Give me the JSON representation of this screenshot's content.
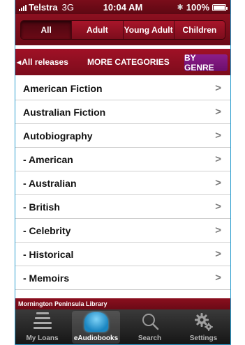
{
  "status_bar": {
    "carrier": "Telstra",
    "network": "3G",
    "time": "10:04 AM",
    "battery": "100%"
  },
  "audience_tabs": {
    "items": [
      "All",
      "Adult",
      "Young Adult",
      "Children"
    ],
    "selected": "All"
  },
  "category_nav": {
    "back_label": "All releases",
    "more_label": "MORE CATEGORIES",
    "genre_label": "BY GENRE"
  },
  "genres": [
    "American Fiction",
    "Australian Fiction",
    "Autobiography",
    "- American",
    "- Australian",
    "- British",
    "- Celebrity",
    "- Historical",
    "- Memoirs"
  ],
  "library_name": "Mornington Peninsula Library",
  "tab_bar": {
    "items": [
      {
        "label": "My Loans",
        "icon": "loans-icon"
      },
      {
        "label": "eAudiobooks",
        "icon": "headphones-icon"
      },
      {
        "label": "Search",
        "icon": "search-icon"
      },
      {
        "label": "Settings",
        "icon": "gear-icon"
      }
    ],
    "selected": "eAudiobooks"
  },
  "colors": {
    "brand": "#8c1020",
    "genre_button": "#7d157c",
    "active_icon": "#1a86c2"
  }
}
